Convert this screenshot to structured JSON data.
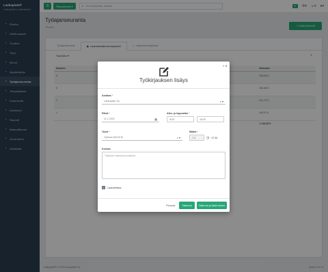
{
  "brand": {
    "name": "Laskupiste®",
    "account": "Laskupiste (Laskutus) ▾"
  },
  "sidebar": {
    "items": [
      {
        "label": "Etusivu",
        "icon": "home-icon"
      },
      {
        "label": "Liiketunnparit",
        "icon": "user-icon"
      },
      {
        "label": "Tuotteet",
        "icon": "box-icon"
      },
      {
        "label": "Tulot",
        "icon": "wallet-icon"
      },
      {
        "label": "Menot",
        "icon": "cart-icon"
      },
      {
        "label": "Ajopäiväkirja",
        "icon": "car-icon"
      },
      {
        "label": "Työajanseuranta",
        "icon": "clock-icon",
        "active": true
      },
      {
        "label": "Tilinpäätökset",
        "icon": "book-icon"
      },
      {
        "label": "Dokumentit",
        "icon": "file-icon"
      },
      {
        "label": "Asetukset",
        "icon": "gear-icon"
      },
      {
        "label": "Raportit",
        "icon": "chart-icon"
      },
      {
        "label": "Maksuliikenne",
        "icon": "bank-icon"
      },
      {
        "label": "Omat tiedot",
        "icon": "id-icon"
      },
      {
        "label": "Asiakkaat",
        "icon": "people-icon"
      }
    ]
  },
  "topbar": {
    "menu_glyph": "≡",
    "quick_label": "Pikavalinnat ▾",
    "search_placeholder": "Etsi asiakkaita, laskuja"
  },
  "page": {
    "title": "Työajanseuranta",
    "crumb": "Etusivu",
    "add_button": "+ Lisää työtunnit"
  },
  "card": {
    "tabs": [
      "Työajanseuranta",
      "Laskuttamattomat kirjaukset",
      "Laskutetut kirjaukset"
    ],
    "tools_label": "Taulukko ▾",
    "table": {
      "headers": [
        "Numero",
        "Päivä",
        "",
        "",
        "",
        "",
        "",
        "",
        "Määrä",
        "Hinnasto"
      ],
      "rows": [
        {
          "num": "6",
          "date": "11.1.2",
          "qty": "7,40 h",
          "price": "258,88 €"
        },
        {
          "num": "5",
          "date": "4.1.20",
          "qty": "7,5 h",
          "price": "262,88 €"
        },
        {
          "num": "2",
          "date": "4.1.20",
          "qty": "8,5 h",
          "price": "441,70 €"
        },
        {
          "num": "1",
          "date": "3.1.20",
          "qty": "8,50 h",
          "price": "453,67 €"
        }
      ],
      "sum_label": "Yht.",
      "sum_qty": "31,75 h",
      "sum_price": "1 143,29 €"
    }
  },
  "modal": {
    "title": "Työkirjauksen lisäys",
    "help": "?",
    "customer_label": "Asiakas",
    "customer_value": "Laskupiste Oy",
    "date_label": "Päivä",
    "date_value": "11.1.2022",
    "time_label": "Alku- ja loppuaika",
    "time_start": "8:00",
    "time_end": "16:00",
    "product_label": "Tuote",
    "product_value": "Työtunti (99,00 €)",
    "qty_label": "Määrä",
    "qty_value": "7,5",
    "duration_value": "07:30",
    "desc_label": "Kuvaus",
    "desc_placeholder": "Tilauksen valmistus tuntityönä",
    "billable_label": "Laskutettava",
    "cancel_label": "Peruuta",
    "save_label": "Tallenna",
    "save_new_label": "Tallenna ja lisää toinen"
  },
  "footer": {
    "copyright": "Laskupiste® © 2023 Laskupiste Oy",
    "version": "versio 12.4.1 ▾"
  },
  "colors": {
    "accent": "#28a777",
    "sidebar": "#2c3e50"
  }
}
